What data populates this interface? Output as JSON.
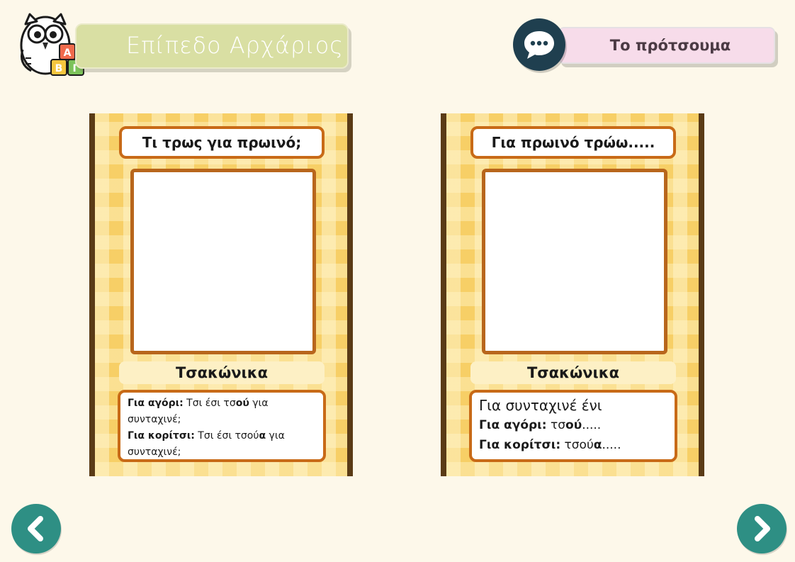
{
  "header": {
    "level_title": "Επίπεδο Αρχάριος",
    "logo_letters": [
      "Α",
      "Β",
      "Γ"
    ],
    "pronoun_label": "Το πρότσουμα"
  },
  "cards": [
    {
      "title": "Τι τρως για πρωινό;",
      "language": "Τσακώνικα",
      "lines": [
        {
          "label": "Για αγόρι:",
          "text_1": "Τσι έσι τσ",
          "bold": "ού",
          "text_2": " για συνταχινέ;"
        },
        {
          "label": "Για κορίτσι:",
          "text_1": "Τσι έσι τσού",
          "bold": "α",
          "text_2": " για συνταχινέ;"
        }
      ]
    },
    {
      "title": "Για πρωινό τρώω.....",
      "language": "Τσακώνικα",
      "intro": "Για συνταχινέ ένι",
      "lines": [
        {
          "label": "Για αγόρι:",
          "text_1": "τσ",
          "bold": "ού",
          "text_2": "....."
        },
        {
          "label": "Για κορίτσι:",
          "text_1": "τσού",
          "bold": "α",
          "text_2": "....."
        }
      ]
    }
  ],
  "colors": {
    "background": "#fdf8ea",
    "card_frame": "#5a3b16",
    "card_border": "#c86a17",
    "nav": "#2e8f84",
    "pronoun_bg": "#f7dcea",
    "level_bg": "#d9dfa3"
  },
  "icons": {
    "logo": "owl-with-abc-blocks-icon",
    "pronoun": "speech-bubble-icon",
    "prev": "chevron-left-icon",
    "next": "chevron-right-icon"
  }
}
